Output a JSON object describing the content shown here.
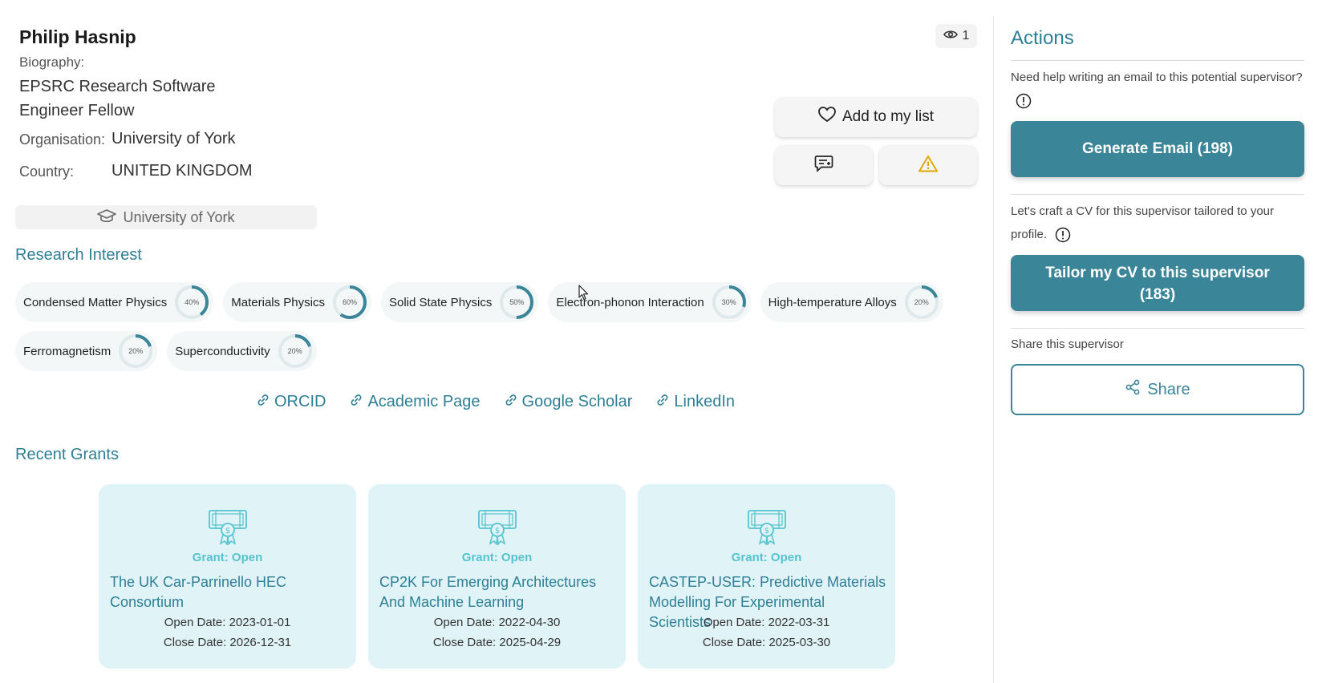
{
  "profile": {
    "name": "Philip Hasnip",
    "biography_label": "Biography:",
    "biography": "EPSRC Research Software Engineer Fellow",
    "organisation_label": "Organisation:",
    "organisation": "University of York",
    "country_label": "Country:",
    "country": "UNITED KINGDOM",
    "university_badge": "University of York",
    "views": "1"
  },
  "buttons": {
    "add_to_list": "Add to my list",
    "comment_icon": "comment-plus-icon",
    "report_icon": "warning-icon"
  },
  "research": {
    "title": "Research Interest",
    "interests": [
      {
        "label": "Condensed Matter Physics",
        "percent": "40%",
        "value": 0.4
      },
      {
        "label": "Materials Physics",
        "percent": "60%",
        "value": 0.6
      },
      {
        "label": "Solid State Physics",
        "percent": "50%",
        "value": 0.5
      },
      {
        "label": "Electron-phonon Interaction",
        "percent": "30%",
        "value": 0.3
      },
      {
        "label": "High-temperature Alloys",
        "percent": "20%",
        "value": 0.2
      },
      {
        "label": "Ferromagnetism",
        "percent": "20%",
        "value": 0.2
      },
      {
        "label": "Superconductivity",
        "percent": "20%",
        "value": 0.2
      }
    ]
  },
  "links": [
    "ORCID",
    "Academic Page",
    "Google Scholar",
    "LinkedIn"
  ],
  "grants": {
    "title": "Recent Grants",
    "items": [
      {
        "status": "Grant: Open",
        "title": "The UK Car-Parrinello HEC Consortium",
        "open": "Open Date: 2023-01-01",
        "close": "Close Date: 2026-12-31"
      },
      {
        "status": "Grant: Open",
        "title": "CP2K For Emerging Architectures And Machine Learning",
        "open": "Open Date: 2022-04-30",
        "close": "Close Date: 2025-04-29"
      },
      {
        "status": "Grant: Open",
        "title": "CASTEP-USER: Predictive Materials Modelling For Experimental Scientists",
        "open": "Open Date: 2022-03-31",
        "close": "Close Date: 2025-03-30"
      }
    ]
  },
  "actions": {
    "title": "Actions",
    "email_help": "Need help writing an email to this potential supervisor?",
    "generate_email": "Generate Email (198)",
    "cv_help": "Let's craft a CV for this supervisor tailored to your profile.",
    "tailor_cv_line1": "Tailor my CV to this supervisor",
    "tailor_cv_line2": "(183)",
    "share_label": "Share this supervisor",
    "share_button": "Share"
  },
  "colors": {
    "accent": "#2e7f96",
    "primary_button": "#3b8599",
    "grant_card": "#e0f3f6",
    "grant_status": "#55c3cf",
    "warning": "#e0a800"
  }
}
